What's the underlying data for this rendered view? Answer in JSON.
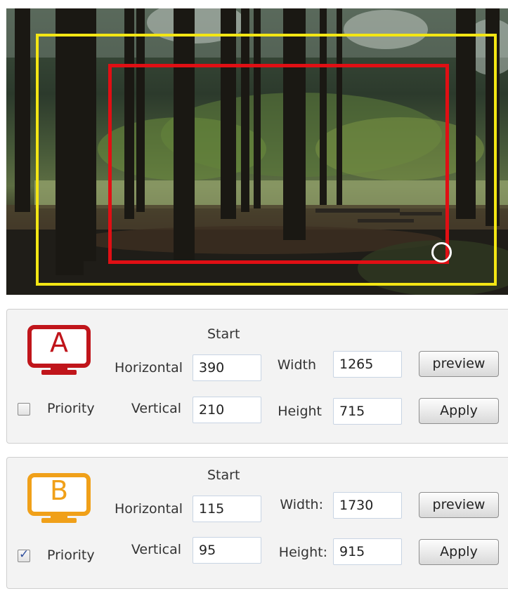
{
  "panel_a": {
    "letter": "A",
    "color": "#c0151b",
    "start_label": "Start",
    "horizontal_label": "Horizontal",
    "horizontal_value": "390",
    "vertical_label": "Vertical",
    "vertical_value": "210",
    "width_label": "Width",
    "width_value": "1265",
    "height_label": "Height",
    "height_value": "715",
    "priority_label": "Priority",
    "priority_checked": false,
    "preview_label": "preview",
    "apply_label": "Apply"
  },
  "panel_b": {
    "letter": "B",
    "color": "#f0a019",
    "start_label": "Start",
    "horizontal_label": "Horizontal",
    "horizontal_value": "115",
    "vertical_label": "Vertical",
    "vertical_value": "95",
    "width_label": "Width:",
    "width_value": "1730",
    "height_label": "Height:",
    "height_value": "915",
    "priority_label": "Priority",
    "priority_checked": true,
    "preview_label": "preview",
    "apply_label": "Apply"
  },
  "preview": {
    "outer_region_color": "#f3e614",
    "inner_region_color": "#e00f14",
    "handle_color": "#ffffff"
  }
}
